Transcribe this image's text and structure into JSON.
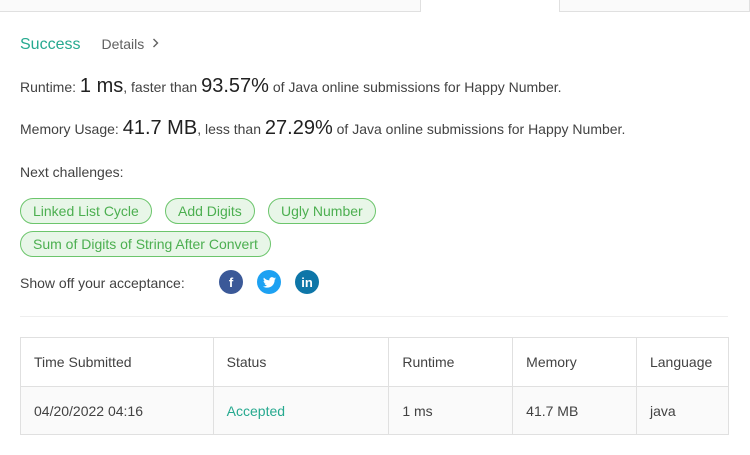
{
  "result": {
    "status": "Success",
    "details_label": "Details",
    "details_icon": "chevron-right-icon"
  },
  "runtime": {
    "label": "Runtime:",
    "value": "1 ms",
    "middle": ", faster than",
    "percent": "93.57%",
    "suffix": "of Java online submissions for Happy Number."
  },
  "memory": {
    "label": "Memory Usage:",
    "value": "41.7 MB",
    "middle": ", less than",
    "percent": "27.29%",
    "suffix": "of Java online submissions for Happy Number."
  },
  "next": {
    "label": "Next challenges:",
    "challenges": [
      "Linked List Cycle",
      "Add Digits",
      "Ugly Number",
      "Sum of Digits of String After Convert"
    ]
  },
  "share": {
    "label": "Show off your acceptance:",
    "icons": [
      "facebook-icon",
      "twitter-icon",
      "linkedin-icon"
    ],
    "facebook_glyph": "f",
    "twitter_glyph": "🐦",
    "linkedin_glyph": "in"
  },
  "table": {
    "headers": [
      "Time Submitted",
      "Status",
      "Runtime",
      "Memory",
      "Language"
    ],
    "rows": [
      [
        "04/20/2022 04:16",
        "Accepted",
        "1 ms",
        "41.7 MB",
        "java"
      ]
    ]
  },
  "colors": {
    "accent": "#26a98f",
    "chip_border": "#6cc56c",
    "chip_bg": "#e8f6e8",
    "facebook": "#3b5998",
    "twitter": "#1da1f2",
    "linkedin": "#0e76a8"
  }
}
